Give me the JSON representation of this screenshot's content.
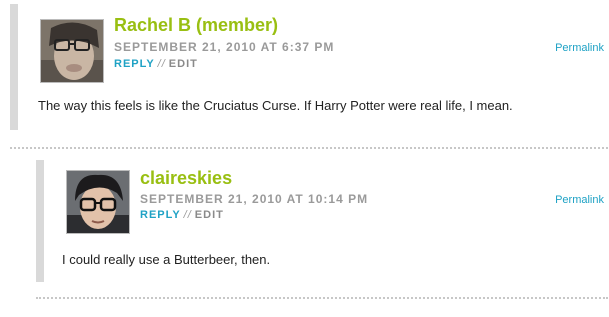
{
  "comments": [
    {
      "author": "Rachel B (member)",
      "date": "SEPTEMBER 21, 2010 AT 6:37 PM",
      "reply_label": "REPLY",
      "separator": "//",
      "edit_label": "EDIT",
      "permalink_label": "Permalink",
      "body": "The way this feels is like the Cruciatus Curse. If Harry Potter were real life, I mean."
    },
    {
      "author": "claireskies",
      "date": "SEPTEMBER 21, 2010 AT 10:14 PM",
      "reply_label": "REPLY",
      "separator": "//",
      "edit_label": "EDIT",
      "permalink_label": "Permalink",
      "body": "I could really use a Butterbeer, then."
    }
  ],
  "colors": {
    "author": "#99bf12",
    "link": "#1fa2c5",
    "meta": "#9a9a9a",
    "bar": "#d9d9d9"
  }
}
